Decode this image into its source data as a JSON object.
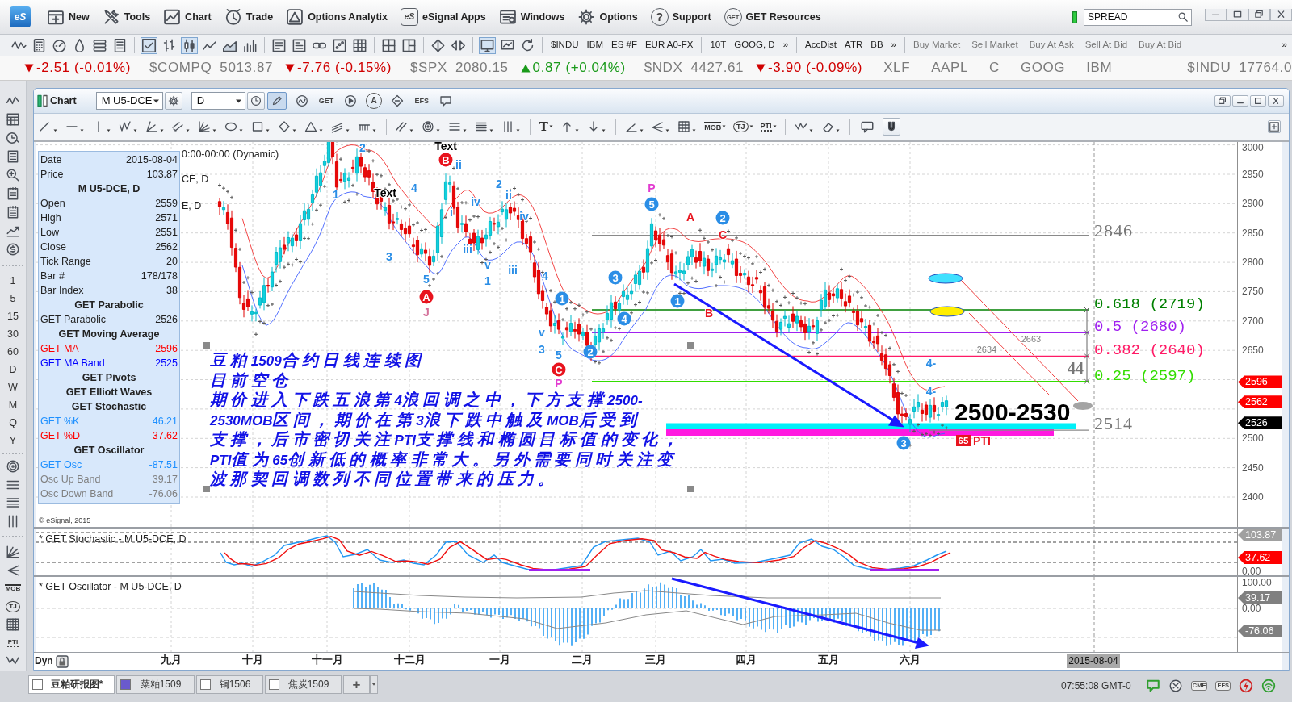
{
  "menu_bar": {
    "logo": "eS",
    "items": [
      {
        "label": "New"
      },
      {
        "label": "Tools"
      },
      {
        "label": "Chart"
      },
      {
        "label": "Trade"
      },
      {
        "label": "Options Analytix"
      },
      {
        "label": "eSignal Apps",
        "badge": "eS"
      },
      {
        "label": "Windows"
      },
      {
        "label": "Options"
      },
      {
        "label": "Support",
        "badge": "?"
      },
      {
        "label": "GET Resources",
        "badge": "GET"
      }
    ],
    "search": {
      "value": "SPREAD"
    }
  },
  "toolbar": {
    "symbols": [
      "$INDU",
      "IBM",
      "ES #F",
      "EUR A0-FX",
      "10T",
      "GOOG, D"
    ],
    "studies": [
      "AccDist",
      "ATR",
      "BB"
    ],
    "trade_buttons": [
      "Buy Market",
      "Sell Market",
      "Buy At Ask",
      "Sell At Bid",
      "Buy At Bid"
    ],
    "overflow": [
      "»",
      "»",
      "»"
    ]
  },
  "ticker": [
    {
      "kind": "change",
      "rising": false,
      "text": "-2.51 (-0.01%)"
    },
    {
      "kind": "quote",
      "symbol": "$COMPQ",
      "price": "5013.87"
    },
    {
      "kind": "change",
      "rising": false,
      "text": "-7.76 (-0.15%)"
    },
    {
      "kind": "quote",
      "symbol": "$SPX",
      "price": "2080.15"
    },
    {
      "kind": "change",
      "rising": true,
      "text": "0.87 (+0.04%)"
    },
    {
      "kind": "quote",
      "symbol": "$NDX",
      "price": "4427.61"
    },
    {
      "kind": "change",
      "rising": false,
      "text": "-3.90 (-0.09%)"
    },
    {
      "kind": "symbol",
      "symbol": "XLF"
    },
    {
      "kind": "symbol",
      "symbol": "AAPL"
    },
    {
      "kind": "symbol",
      "symbol": "C"
    },
    {
      "kind": "symbol",
      "symbol": "GOOG"
    },
    {
      "kind": "symbol",
      "symbol": "IBM"
    },
    {
      "kind": "quote",
      "symbol": "$INDU",
      "price": "17764.0"
    }
  ],
  "sidebar": {
    "intervals": [
      "1",
      "5",
      "15",
      "30",
      "60",
      "D",
      "W",
      "M",
      "Q",
      "Y"
    ],
    "tools": [
      "MOB",
      "TJ",
      "PTI"
    ]
  },
  "chart_window": {
    "title": "Chart",
    "symbol": "M U5-DCE",
    "interval": "D",
    "toolbar_badges": [
      "GET",
      "A",
      "EFS"
    ],
    "drawing_tools": [
      "T",
      "MOB",
      "TJ",
      "PTI"
    ]
  },
  "price_panel": {
    "titles": [
      "0:00-00:00 (Dynamic)",
      "CE, D",
      "E, D"
    ],
    "data_window": [
      {
        "kind": "field",
        "label": "Date",
        "value": "2015-08-04"
      },
      {
        "kind": "field",
        "label": "Price",
        "value": "103.87"
      },
      {
        "kind": "header",
        "label": "M U5-DCE, D"
      },
      {
        "kind": "field",
        "label": "Open",
        "value": "2559"
      },
      {
        "kind": "field",
        "label": "High",
        "value": "2571"
      },
      {
        "kind": "field",
        "label": "Low",
        "value": "2551"
      },
      {
        "kind": "field",
        "label": "Close",
        "value": "2562"
      },
      {
        "kind": "field",
        "label": "Tick Range",
        "value": "20"
      },
      {
        "kind": "field",
        "label": "Bar #",
        "value": "178/178"
      },
      {
        "kind": "field",
        "label": "Bar Index",
        "value": "38"
      },
      {
        "kind": "header",
        "label": "GET Parabolic"
      },
      {
        "kind": "field",
        "label": "GET Parabolic",
        "value": "2526"
      },
      {
        "kind": "header",
        "label": "GET Moving Average"
      },
      {
        "kind": "field",
        "label": "GET MA",
        "value": "2596",
        "color": "#ff0000"
      },
      {
        "kind": "field",
        "label": "GET MA Band",
        "value": "2525",
        "color": "#0000ff"
      },
      {
        "kind": "header",
        "label": "GET Pivots"
      },
      {
        "kind": "header",
        "label": "GET Elliott Waves"
      },
      {
        "kind": "header",
        "label": "GET Stochastic"
      },
      {
        "kind": "field",
        "label": "GET %K",
        "value": "46.21",
        "color": "#1e90ff"
      },
      {
        "kind": "field",
        "label": "GET %D",
        "value": "37.62",
        "color": "#ff0000"
      },
      {
        "kind": "header",
        "label": "GET Oscillator"
      },
      {
        "kind": "field",
        "label": "GET Osc",
        "value": "-87.51",
        "color": "#1e90ff"
      },
      {
        "kind": "field",
        "label": "Osc Up Band",
        "value": "39.17",
        "color": "#808080"
      },
      {
        "kind": "field",
        "label": "Osc Down Band",
        "value": "-76.06",
        "color": "#808080"
      }
    ],
    "note": [
      "豆粕1509合约日线连续图",
      "目前空仓",
      "期价进入下跌五浪第4浪回调之中，下方支撑2500-",
      "2530MOB区间，期价在第3浪下跌中触及MOB后受到",
      "支撑，后市密切关注PTI支撑线和椭圆目标值的变化，",
      "PTI值为65创新低的概率非常大。另外需要同时关注变",
      "波那契回调数列不同位置带来的压力。"
    ],
    "labels": [
      {
        "text": "2",
        "kind": "wave",
        "color": "#2b8ee6"
      },
      {
        "text": "Text",
        "kind": "text",
        "color": "#000000"
      },
      {
        "text": "B",
        "kind": "circled",
        "color": "#e8141e"
      },
      {
        "text": "ii",
        "kind": "wave",
        "color": "#2b8ee6"
      },
      {
        "text": "1",
        "kind": "wave",
        "color": "#2b8ee6"
      },
      {
        "text": "Text",
        "kind": "text",
        "color": "#000000"
      },
      {
        "text": "4",
        "kind": "wave",
        "color": "#2b8ee6"
      },
      {
        "text": "3",
        "kind": "wave",
        "color": "#2b8ee6"
      },
      {
        "text": "5",
        "kind": "wave",
        "color": "#2b8ee6"
      },
      {
        "text": "A",
        "kind": "circled",
        "color": "#e8141e"
      },
      {
        "text": "J",
        "kind": "wave",
        "color": "#d4709a"
      },
      {
        "text": "i",
        "kind": "wave",
        "color": "#2b8ee6"
      },
      {
        "text": "iv",
        "kind": "wave",
        "color": "#2b8ee6"
      },
      {
        "text": "iii",
        "kind": "wave",
        "color": "#2b8ee6"
      },
      {
        "text": "v",
        "kind": "wave",
        "color": "#2b8ee6"
      },
      {
        "text": "1",
        "kind": "wave",
        "color": "#2b8ee6"
      },
      {
        "text": "2",
        "kind": "wave",
        "color": "#2b8ee6"
      },
      {
        "text": "ii",
        "kind": "wave",
        "color": "#2b8ee6"
      },
      {
        "text": "iv",
        "kind": "wave",
        "color": "#2b8ee6"
      },
      {
        "text": "iii",
        "kind": "wave",
        "color": "#2b8ee6"
      },
      {
        "text": "4",
        "kind": "wave",
        "color": "#2b8ee6"
      },
      {
        "text": "v",
        "kind": "wave",
        "color": "#2b8ee6"
      },
      {
        "text": "3",
        "kind": "wave",
        "color": "#2b8ee6"
      },
      {
        "text": "5",
        "kind": "wave",
        "color": "#2b8ee6"
      },
      {
        "text": "C",
        "kind": "circled",
        "color": "#e8141e"
      },
      {
        "text": "P",
        "kind": "wave",
        "color": "#e23cd0"
      },
      {
        "text": "1",
        "kind": "circled",
        "color": "#2b8ee6"
      },
      {
        "text": "2",
        "kind": "circled",
        "color": "#2b8ee6"
      },
      {
        "text": "3",
        "kind": "circled",
        "color": "#2b8ee6"
      },
      {
        "text": "4",
        "kind": "circled",
        "color": "#2b8ee6"
      },
      {
        "text": "P",
        "kind": "wave",
        "color": "#e23cd0"
      },
      {
        "text": "5",
        "kind": "circled",
        "color": "#2b8ee6"
      },
      {
        "text": "1",
        "kind": "circled",
        "color": "#2b8ee6"
      },
      {
        "text": "A",
        "kind": "wave",
        "color": "#e8141e"
      },
      {
        "text": "B",
        "kind": "wave",
        "color": "#e8141e"
      },
      {
        "text": "2",
        "kind": "circled",
        "color": "#2b8ee6"
      },
      {
        "text": "C",
        "kind": "wave",
        "color": "#e8141e"
      },
      {
        "text": "4-",
        "kind": "wave",
        "color": "#2b8ee6"
      },
      {
        "text": "4-",
        "kind": "wave",
        "color": "#2b8ee6"
      },
      {
        "text": "3",
        "kind": "circled",
        "color": "#2b8ee6"
      },
      {
        "text": "65",
        "kind": "tag",
        "color": "#e8141e"
      },
      {
        "text": "PTI",
        "kind": "text",
        "color": "#e8141e"
      },
      {
        "text": "2663",
        "kind": "price",
        "color": "#808080"
      },
      {
        "text": "2634",
        "kind": "price",
        "color": "#808080"
      }
    ],
    "fib_levels": [
      {
        "text": "0.618 (2719)",
        "color": "#008000"
      },
      {
        "text": "0.5 (2680)",
        "color": "#a020f0"
      },
      {
        "text": "0.382 (2640)",
        "color": "#ff1a66"
      },
      {
        "text": "0.25 (2597)",
        "color": "#33dd00"
      }
    ],
    "levels": [
      "2846",
      "2514"
    ],
    "measure": "44",
    "target": "2500-2530",
    "axis_ticks": [
      "3000",
      "2950",
      "2900",
      "2850",
      "2800",
      "2750",
      "2700",
      "2650",
      "2500",
      "2450",
      "2400"
    ],
    "axis_tags": [
      {
        "text": "2596",
        "color": "#ff0000"
      },
      {
        "text": "2562",
        "color": "#ff0000"
      },
      {
        "text": "2526",
        "color": "#000000"
      }
    ],
    "copyright": "© eSignal, 2015"
  },
  "stochastic_panel": {
    "title": "* GET Stochastic - M U5-DCE, D",
    "axis_ticks": [
      "0.00"
    ],
    "axis_tags": [
      {
        "text": "103.87",
        "color": "#a0a0a0"
      },
      {
        "text": "37.62",
        "color": "#ff0000"
      }
    ]
  },
  "oscillator_panel": {
    "title": "* GET Oscillator - M U5-DCE, D",
    "axis_ticks": [
      "100.00",
      "0.00"
    ],
    "axis_tags": [
      {
        "text": "39.17",
        "color": "#808080"
      },
      {
        "text": "-76.06",
        "color": "#808080"
      }
    ]
  },
  "x_axis": {
    "mode": "Dyn",
    "months": [
      "九月",
      "十月",
      "十一月",
      "十二月",
      "一月",
      "二月",
      "三月",
      "四月",
      "五月",
      "六月"
    ],
    "cursor_date": "2015-08-04"
  },
  "tabs": [
    {
      "label": "豆粕研报图*",
      "selected": true,
      "color": "#ffffff"
    },
    {
      "label": "菜粕1509",
      "selected": false,
      "color": "#6a5acd"
    },
    {
      "label": "铜1506",
      "selected": false,
      "color": "#ffffff"
    },
    {
      "label": "焦炭1509",
      "selected": false,
      "color": "#ffffff"
    }
  ],
  "tab_add": "+",
  "status_bar": {
    "time": "07:55:08 GMT-0",
    "badges": [
      "CME",
      "EFS"
    ]
  }
}
